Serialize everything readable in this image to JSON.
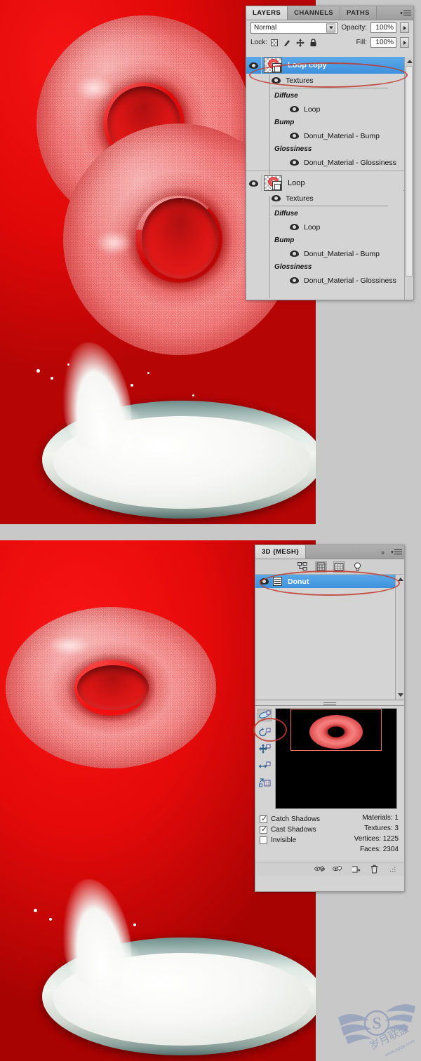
{
  "app": "Adobe Photoshop",
  "canvas": {
    "background_color": "#ed0b0b",
    "top": {
      "name": "top-tutorial-image",
      "subject": "two overlapping red textured donuts above a bowl of splashing milk"
    },
    "bottom": {
      "name": "bottom-tutorial-image",
      "subject": "single red textured donut above a bowl of splashing milk"
    }
  },
  "layers_panel": {
    "tabs": [
      {
        "label": "LAYERS",
        "active": true
      },
      {
        "label": "CHANNELS",
        "active": false
      },
      {
        "label": "PATHS",
        "active": false
      }
    ],
    "blend_mode": "Normal",
    "opacity_label": "Opacity:",
    "opacity_value": "100%",
    "lock_label": "Lock:",
    "fill_label": "Fill:",
    "fill_value": "100%",
    "lock_icons": [
      "lock-transparent-pixels-icon",
      "lock-image-pixels-icon",
      "lock-position-icon",
      "lock-all-icon"
    ],
    "groups": [
      {
        "name": "Loop copy",
        "selected": true,
        "children": [
          {
            "label": "Textures",
            "type": "folder"
          },
          {
            "label": "Diffuse",
            "type": "heading"
          },
          {
            "label": "Loop",
            "type": "texture"
          },
          {
            "label": "Bump",
            "type": "heading"
          },
          {
            "label": "Donut_Material - Bump",
            "type": "texture"
          },
          {
            "label": "Glossiness",
            "type": "heading"
          },
          {
            "label": "Donut_Material - Glossiness",
            "type": "texture"
          }
        ]
      },
      {
        "name": "Loop",
        "selected": false,
        "children": [
          {
            "label": "Textures",
            "type": "folder"
          },
          {
            "label": "Diffuse",
            "type": "heading"
          },
          {
            "label": "Loop",
            "type": "texture"
          },
          {
            "label": "Bump",
            "type": "heading"
          },
          {
            "label": "Donut_Material - Bump",
            "type": "texture"
          },
          {
            "label": "Glossiness",
            "type": "heading"
          },
          {
            "label": "Donut_Material - Glossiness",
            "type": "texture"
          }
        ]
      }
    ]
  },
  "three_d_panel": {
    "tab_label": "3D {MESH}",
    "filter_icons": [
      "scene-filter-icon",
      "materials-filter-icon",
      "meshes-filter-icon",
      "lights-filter-icon"
    ],
    "mesh_item": "Donut",
    "tools": [
      "3d-mesh-rotate-icon",
      "3d-mesh-roll-icon",
      "3d-mesh-drag-icon",
      "3d-mesh-slide-icon",
      "3d-mesh-scale-icon"
    ],
    "checkboxes": [
      {
        "label": "Catch Shadows",
        "checked": true
      },
      {
        "label": "Cast Shadows",
        "checked": true
      },
      {
        "label": "Invisible",
        "checked": false
      }
    ],
    "stats": [
      {
        "label": "Materials:",
        "value": "1"
      },
      {
        "label": "Textures:",
        "value": "3"
      },
      {
        "label": "Vertices:",
        "value": "1225"
      },
      {
        "label": "Faces:",
        "value": "2304"
      }
    ],
    "stats_text": [
      "Materials: 1",
      "Textures: 3",
      "Vertices: 1225",
      "Faces: 2304"
    ],
    "bottom_icons": [
      "toggle-ground-plane-icon",
      "toggle-light-icon",
      "new-light-icon",
      "delete-icon"
    ]
  },
  "annotations": {
    "highlight_color": "#c0392b",
    "marks": [
      "ellipse-around-loop-copy-layer",
      "ellipse-around-donut-mesh",
      "ellipse-around-mesh-roll-tool"
    ]
  },
  "watermark": {
    "logo_letter": "S",
    "site_text": "www.syue.com",
    "brand_text": "岁月联盟"
  }
}
